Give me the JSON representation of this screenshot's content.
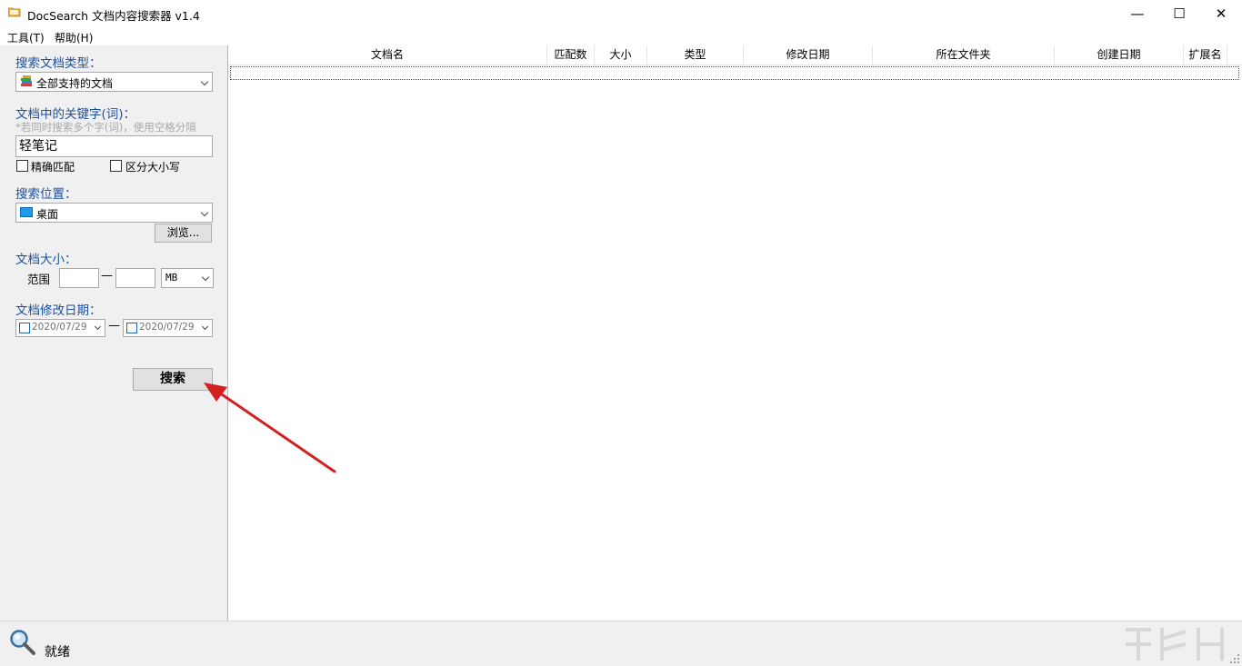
{
  "window": {
    "title": "DocSearch 文档内容搜索器 v1.4",
    "controls": {
      "minimize": "—",
      "maximize": "☐",
      "close": "✕"
    }
  },
  "menu": {
    "tools": "工具(T)",
    "help": "帮助(H)"
  },
  "left": {
    "doc_type_label": "搜索文档类型：",
    "doc_type_value": "全部支持的文档",
    "keyword_label": "文档中的关键字(词)：",
    "keyword_hint": "*若同时搜索多个字(词)，使用空格分隔",
    "keyword_value": "轻笔记",
    "exact_match_label": "精确匹配",
    "case_sensitive_label": "区分大小写",
    "location_label": "搜索位置：",
    "location_value": "桌面",
    "browse_button": "浏览...",
    "size_label": "文档大小：",
    "range_label": "范围",
    "range_dash": "—",
    "size_unit": "MB",
    "date_label": "文档修改日期：",
    "date_from": "2020/07/29",
    "date_to": "2020/07/29",
    "date_dash": "—",
    "search_button": "搜索"
  },
  "results": {
    "columns": [
      "文档名",
      "匹配数",
      "大小",
      "类型",
      "修改日期",
      "所在文件夹",
      "创建日期",
      "扩展名"
    ]
  },
  "status": {
    "text": "就绪"
  },
  "colors": {
    "label_blue": "#1e50a0",
    "annotation_arrow": "#d32020"
  }
}
